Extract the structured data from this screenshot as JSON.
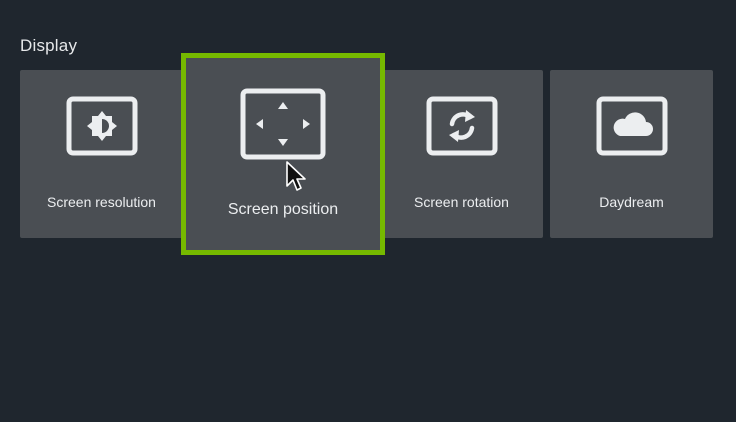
{
  "section": {
    "title": "Display"
  },
  "tiles": [
    {
      "label": "Screen resolution",
      "icon": "brightness-icon",
      "focused": false
    },
    {
      "label": "Screen position",
      "icon": "screen-position-icon",
      "focused": true
    },
    {
      "label": "Screen rotation",
      "icon": "screen-rotation-icon",
      "focused": false
    },
    {
      "label": "Daydream",
      "icon": "cloud-screen-icon",
      "focused": false
    }
  ],
  "colors": {
    "background": "#1f262e",
    "tile": "#4a4e53",
    "focus_border": "#76b900",
    "icon": "#eceef0"
  }
}
